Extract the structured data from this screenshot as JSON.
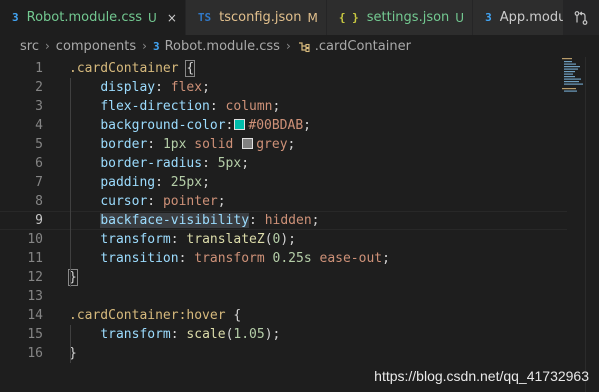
{
  "tabs": [
    {
      "icon": "css-file-icon",
      "glyph": "3",
      "name": "Robot.module.css",
      "status": "U",
      "status_color": "#73c991",
      "active": true,
      "close": "×"
    },
    {
      "icon": "ts-file-icon",
      "glyph": "TS",
      "name": "tsconfig.json",
      "status": "M",
      "status_color": "#e2c08d",
      "active": false
    },
    {
      "icon": "json-file-icon",
      "glyph": "{ }",
      "name": "settings.json",
      "status": "U",
      "status_color": "#73c991",
      "active": false
    },
    {
      "icon": "css-file-icon",
      "glyph": "3",
      "name": "App.modu",
      "status": "",
      "active": false
    }
  ],
  "breadcrumb": {
    "parts": [
      "src",
      "components",
      "Robot.module.css",
      ".cardContainer"
    ],
    "separator": "›"
  },
  "editor": {
    "current_line": 9,
    "lines": [
      {
        "n": "1",
        "tokens": [
          {
            "t": ".cardContainer",
            "c": "sel"
          },
          {
            "t": " ",
            "c": "punc"
          },
          {
            "t": "{",
            "c": "punc brace-hl"
          }
        ]
      },
      {
        "n": "2",
        "tokens": [
          {
            "t": "    ",
            "c": "punc"
          },
          {
            "t": "display",
            "c": "prop"
          },
          {
            "t": ": ",
            "c": "punc"
          },
          {
            "t": "flex",
            "c": "val"
          },
          {
            "t": ";",
            "c": "punc"
          }
        ]
      },
      {
        "n": "3",
        "tokens": [
          {
            "t": "    ",
            "c": "punc"
          },
          {
            "t": "flex-direction",
            "c": "prop"
          },
          {
            "t": ": ",
            "c": "punc"
          },
          {
            "t": "column",
            "c": "val"
          },
          {
            "t": ";",
            "c": "punc"
          }
        ]
      },
      {
        "n": "4",
        "tokens": [
          {
            "t": "    ",
            "c": "punc"
          },
          {
            "t": "background-color",
            "c": "prop"
          },
          {
            "t": ":",
            "c": "punc"
          },
          {
            "swatch": "#00BDAB"
          },
          {
            "t": "#00BDAB",
            "c": "val"
          },
          {
            "t": ";",
            "c": "punc"
          }
        ]
      },
      {
        "n": "5",
        "tokens": [
          {
            "t": "    ",
            "c": "punc"
          },
          {
            "t": "border",
            "c": "prop"
          },
          {
            "t": ": ",
            "c": "punc"
          },
          {
            "t": "1px",
            "c": "num"
          },
          {
            "t": " ",
            "c": "punc"
          },
          {
            "t": "solid",
            "c": "val"
          },
          {
            "t": " ",
            "c": "punc"
          },
          {
            "swatch": "#808080"
          },
          {
            "t": "grey",
            "c": "val"
          },
          {
            "t": ";",
            "c": "punc"
          }
        ]
      },
      {
        "n": "6",
        "tokens": [
          {
            "t": "    ",
            "c": "punc"
          },
          {
            "t": "border-radius",
            "c": "prop"
          },
          {
            "t": ": ",
            "c": "punc"
          },
          {
            "t": "5px",
            "c": "num"
          },
          {
            "t": ";",
            "c": "punc"
          }
        ]
      },
      {
        "n": "7",
        "tokens": [
          {
            "t": "    ",
            "c": "punc"
          },
          {
            "t": "padding",
            "c": "prop"
          },
          {
            "t": ": ",
            "c": "punc"
          },
          {
            "t": "25px",
            "c": "num"
          },
          {
            "t": ";",
            "c": "punc"
          }
        ]
      },
      {
        "n": "8",
        "tokens": [
          {
            "t": "    ",
            "c": "punc"
          },
          {
            "t": "cursor",
            "c": "prop"
          },
          {
            "t": ": ",
            "c": "punc"
          },
          {
            "t": "pointer",
            "c": "val"
          },
          {
            "t": ";",
            "c": "punc"
          }
        ]
      },
      {
        "n": "9",
        "tokens": [
          {
            "t": "    ",
            "c": "punc"
          },
          {
            "t": "backface-visibility",
            "c": "prop word-hl"
          },
          {
            "t": ": ",
            "c": "punc"
          },
          {
            "t": "hidden",
            "c": "val"
          },
          {
            "t": ";",
            "c": "punc"
          }
        ]
      },
      {
        "n": "10",
        "tokens": [
          {
            "t": "    ",
            "c": "punc"
          },
          {
            "t": "transform",
            "c": "prop"
          },
          {
            "t": ": ",
            "c": "punc"
          },
          {
            "t": "translateZ",
            "c": "func"
          },
          {
            "t": "(",
            "c": "punc"
          },
          {
            "t": "0",
            "c": "num"
          },
          {
            "t": ");",
            "c": "punc"
          }
        ]
      },
      {
        "n": "11",
        "tokens": [
          {
            "t": "    ",
            "c": "punc"
          },
          {
            "t": "transition",
            "c": "prop"
          },
          {
            "t": ": ",
            "c": "punc"
          },
          {
            "t": "transform",
            "c": "val"
          },
          {
            "t": " ",
            "c": "punc"
          },
          {
            "t": "0.25s",
            "c": "num"
          },
          {
            "t": " ",
            "c": "punc"
          },
          {
            "t": "ease-out",
            "c": "val"
          },
          {
            "t": ";",
            "c": "punc"
          }
        ]
      },
      {
        "n": "12",
        "tokens": [
          {
            "t": "}",
            "c": "punc brace-hl"
          }
        ]
      },
      {
        "n": "13",
        "tokens": []
      },
      {
        "n": "14",
        "tokens": [
          {
            "t": ".cardContainer:hover",
            "c": "sel"
          },
          {
            "t": " {",
            "c": "punc"
          }
        ]
      },
      {
        "n": "15",
        "tokens": [
          {
            "t": "    ",
            "c": "punc"
          },
          {
            "t": "transform",
            "c": "prop"
          },
          {
            "t": ": ",
            "c": "punc"
          },
          {
            "t": "scale",
            "c": "func"
          },
          {
            "t": "(",
            "c": "punc"
          },
          {
            "t": "1.05",
            "c": "num"
          },
          {
            "t": ");",
            "c": "punc"
          }
        ]
      },
      {
        "n": "16",
        "tokens": [
          {
            "t": "}",
            "c": "punc"
          }
        ]
      }
    ]
  },
  "watermark": "https://blog.csdn.net/qq_41732963"
}
